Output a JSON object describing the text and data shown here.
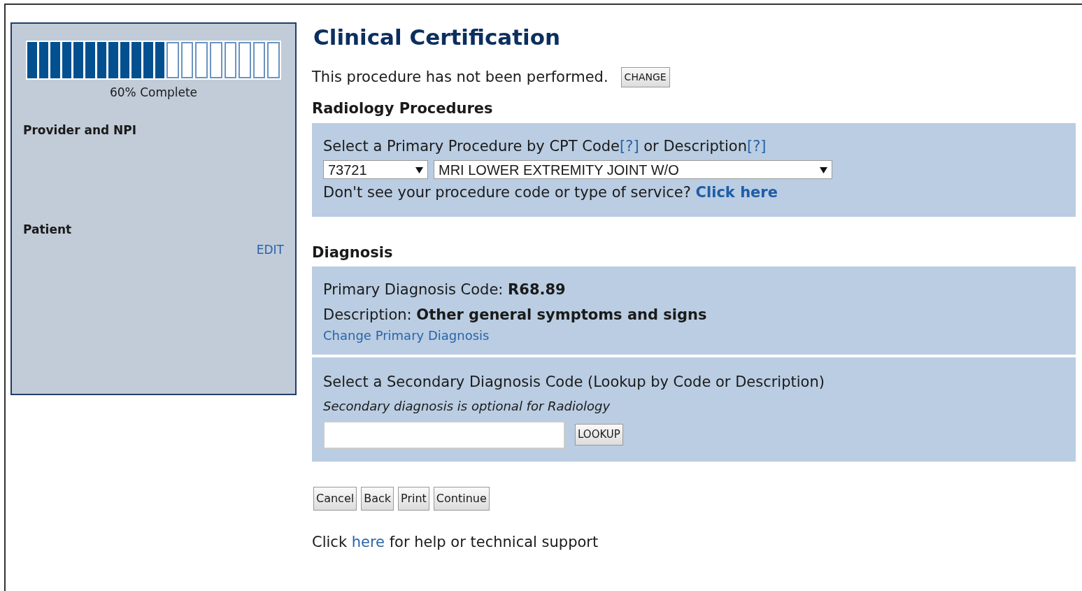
{
  "sidebar": {
    "progress": {
      "level": 0.6,
      "label": "60% Complete"
    },
    "sections": [
      {
        "title": "Provider and NPI"
      },
      {
        "title": "Patient",
        "action": "EDIT"
      }
    ]
  },
  "title": "Clinical Certification",
  "performed": {
    "text": "This procedure has not been performed.",
    "button": "CHANGE"
  },
  "procedures": {
    "heading": "Radiology Procedures",
    "prompt": [
      {
        "text": "Select a Primary Procedure by CPT Code"
      },
      {
        "link": "[?]"
      },
      {
        "text": " or Description"
      },
      {
        "link": "[?]"
      }
    ],
    "code_select": "73721",
    "description_select": "MRI LOWER EXTREMITY JOINT W/O",
    "missing": {
      "text": "Don't see your procedure code or type of service?",
      "link": "Click here"
    }
  },
  "diagnosis": {
    "heading": "Diagnosis",
    "primary_code": "Primary Diagnosis Code: **R68.89**",
    "description": "Description: **Other general symptoms and signs**",
    "change_link": "Change Primary Diagnosis",
    "secondary_title": "Select a Secondary Diagnosis Code (Lookup by Code or Description)",
    "secondary_note": "Secondary diagnosis is optional for Radiology",
    "lookup_button": "LOOKUP"
  },
  "buttons": [
    "Cancel",
    "Back",
    "Print",
    "Continue"
  ],
  "help": {
    "before": "Click",
    "link": "here",
    "after": "for help or technical support"
  }
}
